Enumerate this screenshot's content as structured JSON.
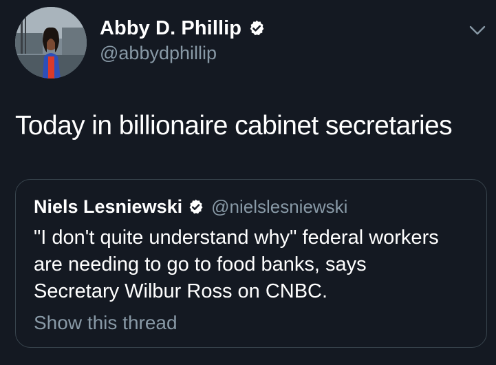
{
  "tweet": {
    "author": {
      "display_name": "Abby D. Phillip",
      "handle": "@abbydphillip",
      "avatar_icon": "profile-photo",
      "verified": true
    },
    "text": "Today in billionaire cabinet secretaries",
    "menu_icon": "chevron-down-icon"
  },
  "quote": {
    "author": {
      "display_name": "Niels Lesniewski",
      "handle": "@nielslesniewski",
      "verified": true
    },
    "text_lines": [
      "\"I don't quite understand why\" federal workers",
      "are needing to go to food banks, says",
      "Secretary Wilbur Ross on CNBC."
    ],
    "show_thread_label": "Show this thread"
  },
  "colors": {
    "background": "#141922",
    "primary_text": "#ffffff",
    "secondary_text": "#8899a6",
    "border": "#38444d"
  }
}
